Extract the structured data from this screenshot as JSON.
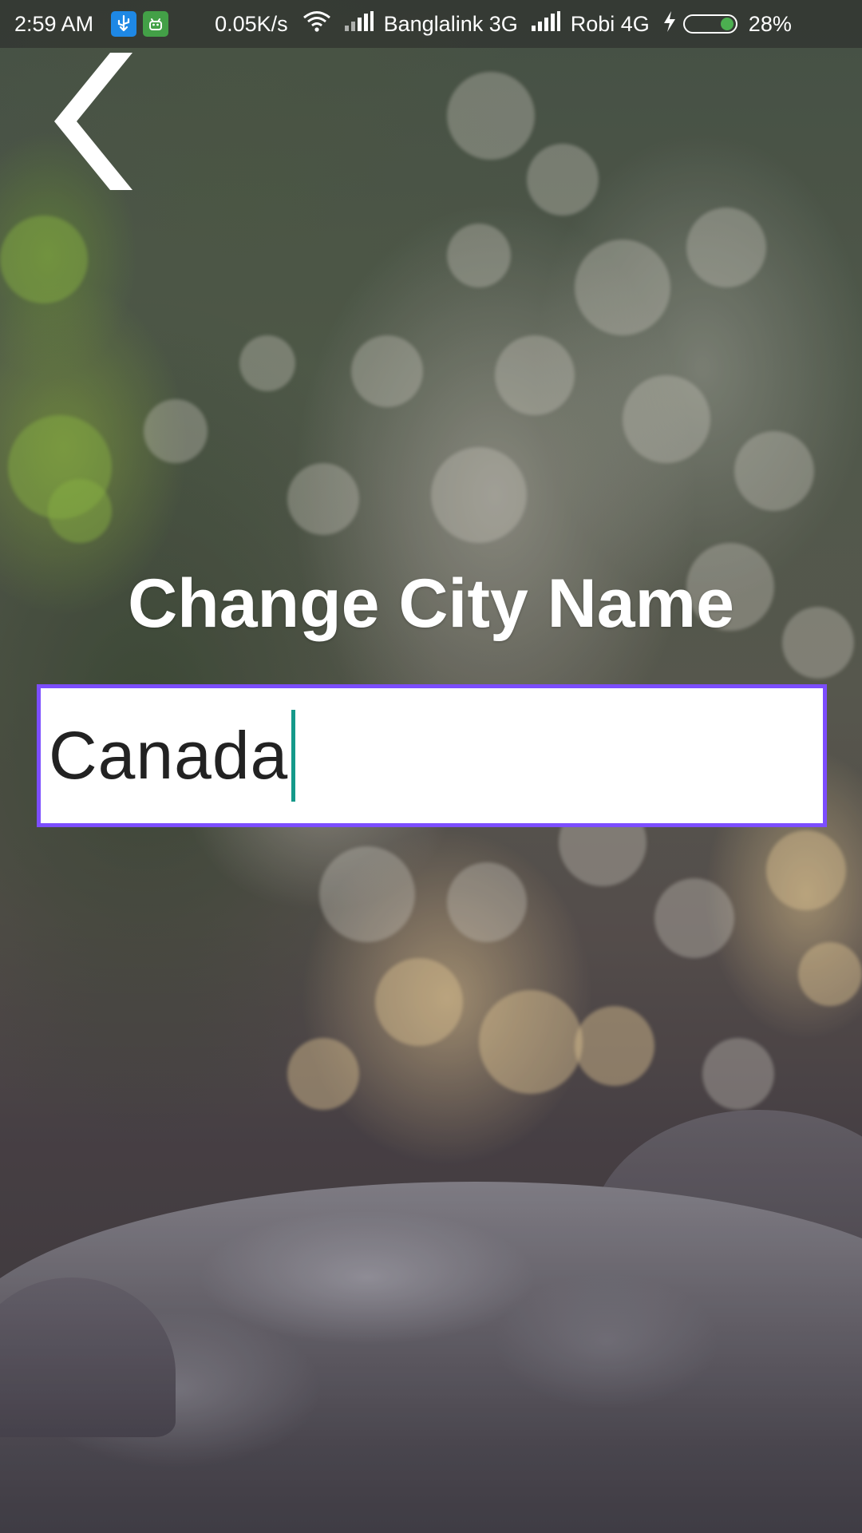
{
  "status_bar": {
    "time": "2:59 AM",
    "usb_icon": "usb-icon",
    "android_icon": "android-debug-icon",
    "net_speed": "0.05K/s",
    "carrier1": "Banglalink 3G",
    "carrier2": "Robi 4G",
    "charging_icon": "lightning-bolt-icon",
    "battery_level": 0.28,
    "battery_percent": "28%"
  },
  "header": {
    "back_icon": "chevron-left-icon"
  },
  "main": {
    "title": "Change City Name",
    "city_input": {
      "value": "Canada",
      "border_color": "#7c4dff",
      "caret_color": "#15998a"
    }
  }
}
